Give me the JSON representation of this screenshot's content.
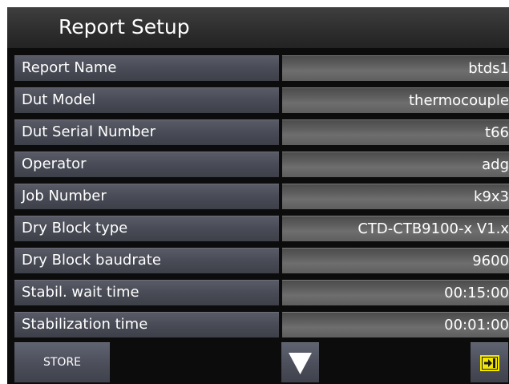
{
  "title": "Report Setup",
  "fields": [
    {
      "label": "Report Name",
      "value": "btds1"
    },
    {
      "label": "Dut Model",
      "value": "thermocouple"
    },
    {
      "label": "Dut Serial Number",
      "value": "t66"
    },
    {
      "label": "Operator",
      "value": "adg"
    },
    {
      "label": "Job Number",
      "value": "k9x3"
    },
    {
      "label": "Dry Block type",
      "value": "CTD-CTB9100-x V1.x"
    },
    {
      "label": "Dry Block baudrate",
      "value": "9600"
    },
    {
      "label": "Stabil. wait time",
      "value": "00:15:00"
    },
    {
      "label": "Stabilization time",
      "value": "00:01:00"
    }
  ],
  "buttons": {
    "store_label": "STORE",
    "scroll_down_icon": "down-triangle-icon",
    "exit_icon": "exit-arrow-icon"
  },
  "colors": {
    "exit_icon_yellow": "#f2e600",
    "screen_bg": "#0c0c0c"
  }
}
